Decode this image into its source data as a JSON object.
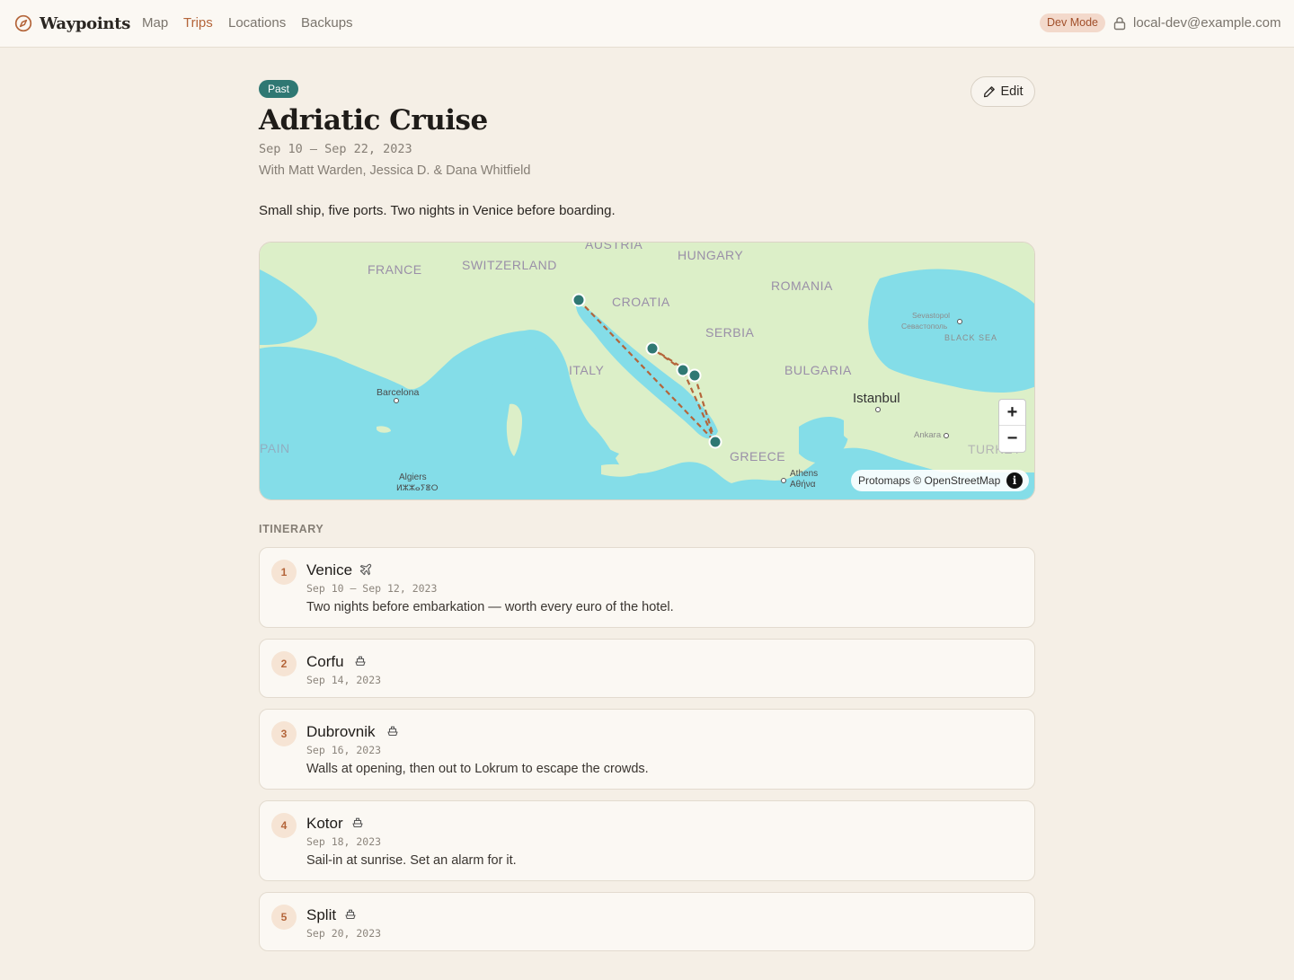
{
  "app": {
    "name": "Waypoints",
    "logo_icon": "compass-icon"
  },
  "nav": {
    "items": [
      {
        "label": "Map",
        "active": false
      },
      {
        "label": "Trips",
        "active": true
      },
      {
        "label": "Locations",
        "active": false
      },
      {
        "label": "Backups",
        "active": false
      }
    ]
  },
  "account": {
    "mode_badge": "Dev Mode",
    "lock_icon": "lock-icon",
    "email": "local-dev@example.com"
  },
  "trip": {
    "status": "Past",
    "title": "Adriatic Cruise",
    "dates": "Sep 10 – Sep 22, 2023",
    "companions": "With Matt Warden, Jessica D. & Dana Whitfield",
    "description": "Small ship, five ports. Two nights in Venice before boarding.",
    "edit_label": "Edit"
  },
  "map": {
    "country_labels": [
      "AUSTRIA",
      "HUNGARY",
      "FRANCE",
      "SWITZERLAND",
      "ROMANIA",
      "CROATIA",
      "SERBIA",
      "ITALY",
      "BULGARIA",
      "GREECE",
      "PAIN",
      "TURKEY"
    ],
    "city_labels": [
      "Barcelona",
      "Istanbul",
      "Ankara",
      "Athens",
      "Αθήνα",
      "Algiers",
      "ⵍⵣⵣⴰⵢⴻⵔ",
      "Sevastopol",
      "Севастополь",
      "BLACK SEA"
    ],
    "zoom_in": "+",
    "zoom_out": "−",
    "attribution": "Protomaps © OpenStreetMap",
    "info": "i",
    "route_color": "#b4653a",
    "marker_color": "#2f7873"
  },
  "itinerary": {
    "title": "ITINERARY",
    "stops": [
      {
        "num": "1",
        "name": "Venice",
        "icon": "plane-icon",
        "date": "Sep 10 – Sep 12, 2023",
        "note": "Two nights before embarkation — worth every euro of the hotel."
      },
      {
        "num": "2",
        "name": "Corfu",
        "icon": "ship-icon",
        "date": "Sep 14, 2023",
        "note": ""
      },
      {
        "num": "3",
        "name": "Dubrovnik",
        "icon": "ship-icon",
        "date": "Sep 16, 2023",
        "note": "Walls at opening, then out to Lokrum to escape the crowds."
      },
      {
        "num": "4",
        "name": "Kotor",
        "icon": "ship-icon",
        "date": "Sep 18, 2023",
        "note": "Sail-in at sunrise. Set an alarm for it."
      },
      {
        "num": "5",
        "name": "Split",
        "icon": "ship-icon",
        "date": "Sep 20, 2023",
        "note": ""
      }
    ]
  }
}
